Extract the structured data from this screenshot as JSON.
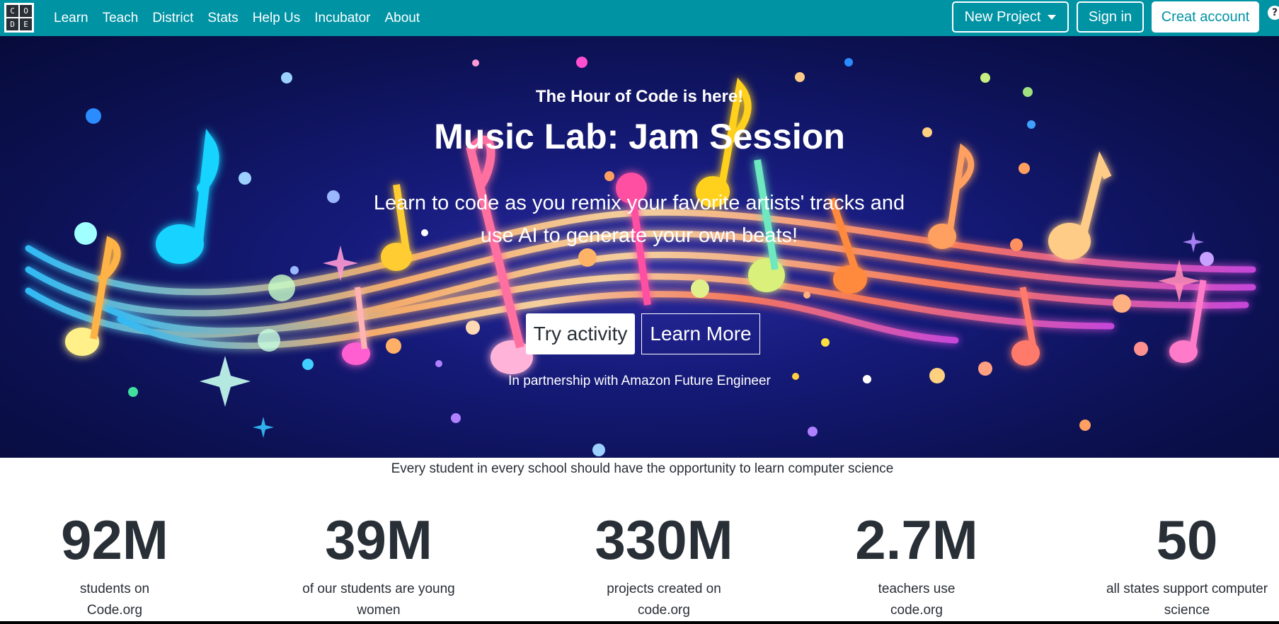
{
  "header": {
    "logo_letters": [
      "C",
      "O",
      "D",
      "E"
    ],
    "nav": [
      "Learn",
      "Teach",
      "District",
      "Stats",
      "Help Us",
      "Incubator",
      "About"
    ],
    "new_project_label": "New Project",
    "sign_in_label": "Sign in",
    "create_account_label": "Creat account",
    "brand_color": "#0093a4"
  },
  "hero": {
    "eyebrow": "The Hour of Code is here!",
    "title": "Music Lab: Jam Session",
    "description": "Learn to code as you remix your favorite artists' tracks and use AI to generate your own beats!",
    "try_label": "Try activity",
    "learn_more_label": "Learn More",
    "partner": "In partnership with Amazon Future Engineer"
  },
  "mission": "Every student in every school should have the opportunity to learn computer science",
  "stats": [
    {
      "value": "92M",
      "label": "students on Code.org"
    },
    {
      "value": "39M",
      "label": "of our students are young women"
    },
    {
      "value": "330M",
      "label": "projects created on code.org"
    },
    {
      "value": "2.7M",
      "label": "teachers use code.org"
    },
    {
      "value": "50",
      "label": "all states support computer science"
    }
  ]
}
